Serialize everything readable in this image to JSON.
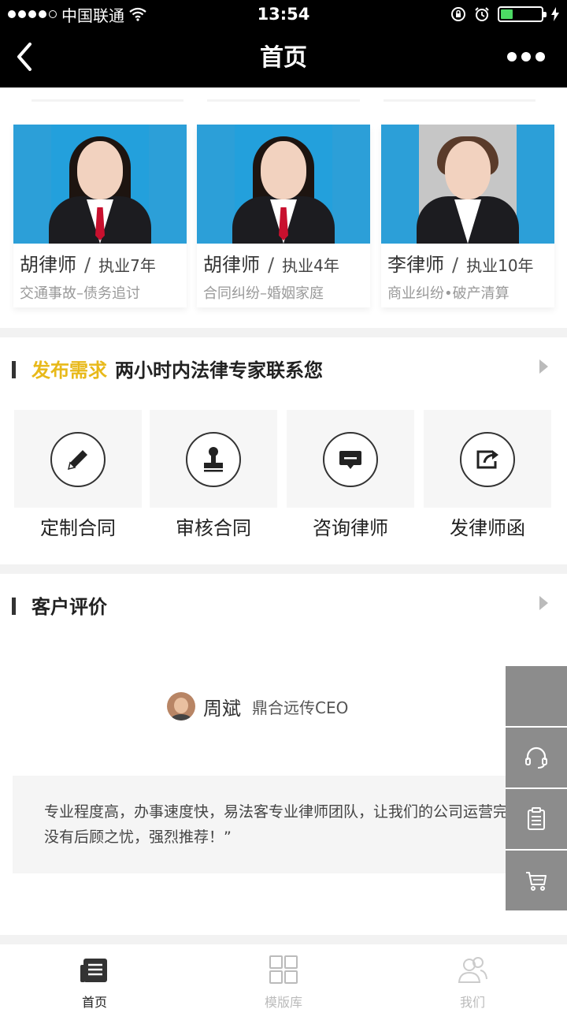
{
  "status_bar": {
    "carrier": "中国联通",
    "time": "13:54",
    "battery_level": 0.3
  },
  "nav": {
    "title": "首页"
  },
  "lawyers": [
    {
      "name": "胡律师",
      "separator": "/",
      "years": "执业7年",
      "specialty": "交通事故–债务追讨",
      "photo_bg": "blue"
    },
    {
      "name": "胡律师",
      "separator": "/",
      "years": "执业4年",
      "specialty": "合同纠纷–婚姻家庭",
      "photo_bg": "blue"
    },
    {
      "name": "李律师",
      "separator": "/",
      "years": "执业10年",
      "specialty": "商业纠纷•破产清算",
      "photo_bg": "grey"
    }
  ],
  "demand": {
    "highlight": "发布需求",
    "title": "两小时内法律专家联系您",
    "accent_color": "#e8b91a",
    "services": [
      {
        "label": "定制合同",
        "icon": "pencil-icon"
      },
      {
        "label": "审核合同",
        "icon": "stamp-icon"
      },
      {
        "label": "咨询律师",
        "icon": "chat-icon"
      },
      {
        "label": "发律师函",
        "icon": "send-letter-icon"
      }
    ]
  },
  "reviews": {
    "title": "客户评价",
    "reviewer_name": "周斌",
    "reviewer_title": "鼎合远传CEO",
    "quote": "专业程度高，办事速度快，易法客专业律师团队，让我们的公司运营完全没有后顾之忧，强烈推荐！”"
  },
  "side_tools": [
    "headset-icon",
    "clipboard-icon",
    "cart-icon"
  ],
  "tabs": [
    {
      "label": "首页",
      "icon": "news-icon",
      "active": true
    },
    {
      "label": "模版库",
      "icon": "grid-icon",
      "active": false
    },
    {
      "label": "我们",
      "icon": "people-icon",
      "active": false
    }
  ]
}
